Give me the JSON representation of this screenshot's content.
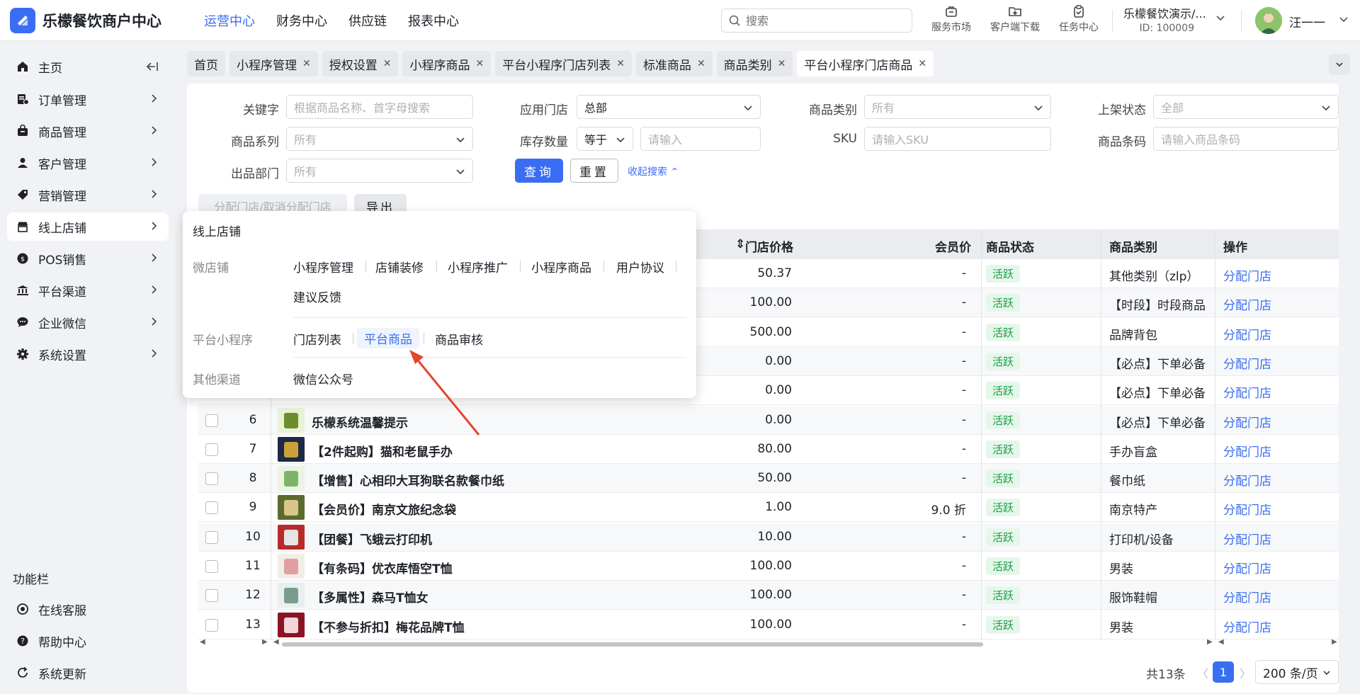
{
  "app": {
    "title": "乐檬餐饮商户中心"
  },
  "topnav": [
    "运营中心",
    "财务中心",
    "供应链",
    "报表中心"
  ],
  "search": {
    "placeholder": "搜索"
  },
  "tools": [
    "服务市场",
    "客户端下载",
    "任务中心"
  ],
  "store": {
    "name": "乐檬餐饮演示/...",
    "id": "ID: 100009"
  },
  "user": {
    "name": "汪一一"
  },
  "sidebar": {
    "items": [
      "主页",
      "订单管理",
      "商品管理",
      "客户管理",
      "营销管理",
      "线上店铺",
      "POS销售",
      "平台渠道",
      "企业微信",
      "系统设置"
    ],
    "section_title": "功能栏",
    "bottom": [
      "在线客服",
      "帮助中心",
      "系统更新"
    ]
  },
  "tabs": [
    "首页",
    "小程序管理",
    "授权设置",
    "小程序商品",
    "平台小程序门店列表",
    "标准商品",
    "商品类别",
    "平台小程序门店商品"
  ],
  "filters": {
    "keyword_label": "关键字",
    "keyword_ph": "根据商品名称、首字母搜索",
    "store_label": "应用门店",
    "store_value": "总部",
    "category_label": "商品类别",
    "category_value": "所有",
    "status_label": "上架状态",
    "status_value": "全部",
    "series_label": "商品系列",
    "series_value": "所有",
    "stock_label": "库存数量",
    "stock_op": "等于",
    "stock_ph": "请输入",
    "sku_label": "SKU",
    "sku_ph": "请输入SKU",
    "barcode_label": "商品条码",
    "barcode_ph": "请输入商品条码",
    "dept_label": "出品部门",
    "dept_value": "所有",
    "query_btn": "查询",
    "reset_btn": "重置",
    "collapse": "收起搜索"
  },
  "actions": {
    "assign": "分配门店/取消分配门店",
    "export": "导出"
  },
  "table": {
    "headers": {
      "price": "门店价格",
      "member": "会员价",
      "status": "商品状态",
      "category": "商品类别",
      "op": "操作"
    },
    "rows": [
      {
        "no": "",
        "name": "",
        "price": "50.37",
        "member": "-",
        "status": "活跃",
        "category": "其他类别（zlp）",
        "op": "分配门店"
      },
      {
        "no": "",
        "name": "",
        "price": "100.00",
        "member": "-",
        "status": "活跃",
        "category": "【时段】时段商品",
        "op": "分配门店"
      },
      {
        "no": "",
        "name": "",
        "price": "500.00",
        "member": "-",
        "status": "活跃",
        "category": "品牌背包",
        "op": "分配门店"
      },
      {
        "no": "",
        "name": "",
        "price": "0.00",
        "member": "-",
        "status": "活跃",
        "category": "【必点】下单必备",
        "op": "分配门店"
      },
      {
        "no": "",
        "name": "",
        "price": "0.00",
        "member": "-",
        "status": "活跃",
        "category": "【必点】下单必备",
        "op": "分配门店"
      },
      {
        "no": "6",
        "name": "乐檬系统温馨提示",
        "price": "0.00",
        "member": "-",
        "status": "活跃",
        "category": "【必点】下单必备",
        "op": "分配门店"
      },
      {
        "no": "7",
        "name": "【2件起购】猫和老鼠手办",
        "price": "80.00",
        "member": "-",
        "status": "活跃",
        "category": "手办盲盒",
        "op": "分配门店"
      },
      {
        "no": "8",
        "name": "【增售】心相印大耳狗联名款餐巾纸",
        "price": "50.00",
        "member": "-",
        "status": "活跃",
        "category": "餐巾纸",
        "op": "分配门店"
      },
      {
        "no": "9",
        "name": "【会员价】南京文旅纪念袋",
        "price": "1.00",
        "member": "9.0 折",
        "status": "活跃",
        "category": "南京特产",
        "op": "分配门店"
      },
      {
        "no": "10",
        "name": "【团餐】飞蛾云打印机",
        "price": "10.00",
        "member": "-",
        "status": "活跃",
        "category": "打印机/设备",
        "op": "分配门店"
      },
      {
        "no": "11",
        "name": "【有条码】优衣库悟空T恤",
        "price": "100.00",
        "member": "-",
        "status": "活跃",
        "category": "男装",
        "op": "分配门店"
      },
      {
        "no": "12",
        "name": "【多属性】森马T恤女",
        "price": "100.00",
        "member": "-",
        "status": "活跃",
        "category": "服饰鞋帽",
        "op": "分配门店"
      },
      {
        "no": "13",
        "name": "【不参与折扣】梅花品牌T恤",
        "price": "100.00",
        "member": "-",
        "status": "活跃",
        "category": "男装",
        "op": "分配门店"
      }
    ]
  },
  "pagination": {
    "total": "共13条",
    "current": "1",
    "size": "200 条/页"
  },
  "popover": {
    "title": "线上店铺",
    "group1": {
      "label": "微店铺",
      "links": [
        "小程序管理",
        "店铺装修",
        "小程序推广",
        "小程序商品",
        "用户协议",
        "建议反馈"
      ]
    },
    "group2": {
      "label": "平台小程序",
      "links": [
        "门店列表",
        "平台商品",
        "商品审核"
      ]
    },
    "group3": {
      "label": "其他渠道",
      "links": [
        "微信公众号"
      ]
    }
  },
  "colors": {
    "accent": "#3a6ef2",
    "active_badge_bg": "#e5f7ea",
    "active_badge_fg": "#1a9e48",
    "arrow": "#e5452f"
  }
}
